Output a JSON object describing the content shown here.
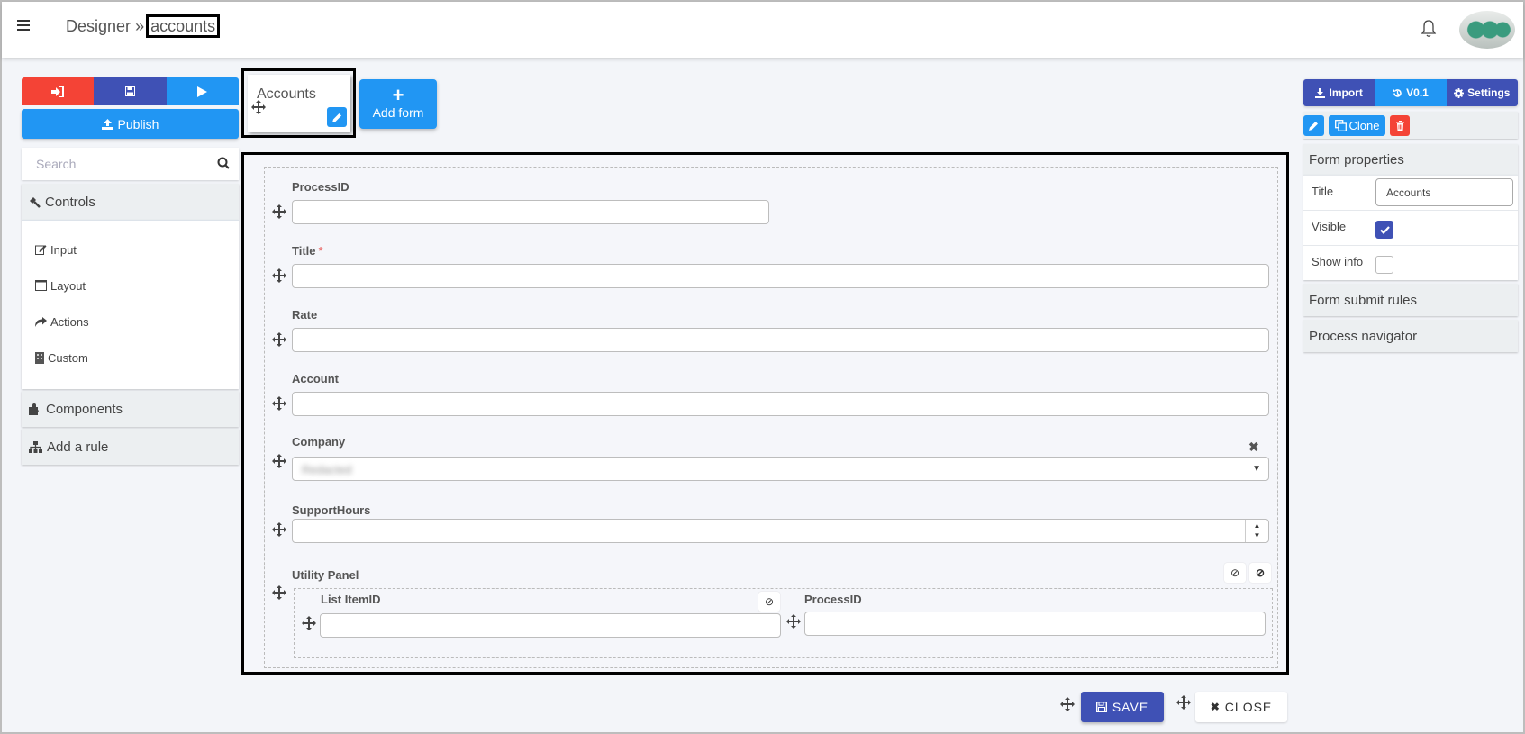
{
  "header": {
    "breadcrumb_root": "Designer",
    "breadcrumb_sep": "»",
    "breadcrumb_current": "accounts",
    "menu_icon": "hamburger-icon",
    "notification_icon": "bell-icon",
    "avatar": "user-avatar"
  },
  "left_sidebar": {
    "top_buttons": [
      {
        "icon": "sign-in-icon",
        "color": "#f44336"
      },
      {
        "icon": "save-icon",
        "color": "#3f51b5"
      },
      {
        "icon": "play-icon",
        "color": "#2196f3"
      }
    ],
    "publish_label": "Publish",
    "search_placeholder": "Search",
    "sections": {
      "controls": "Controls",
      "components": "Components",
      "add_rule": "Add a rule"
    },
    "controls_items": [
      {
        "label": "Input",
        "icon": "edit-icon"
      },
      {
        "label": "Layout",
        "icon": "columns-icon"
      },
      {
        "label": "Actions",
        "icon": "share-icon"
      },
      {
        "label": "Custom",
        "icon": "building-icon"
      }
    ]
  },
  "forms": {
    "tabs": [
      {
        "title": "Accounts"
      }
    ],
    "add_form_label": "Add form"
  },
  "canvas": {
    "fields": [
      {
        "label": "ProcessID",
        "type": "text",
        "value": "",
        "required": false
      },
      {
        "label": "Title",
        "type": "text",
        "value": "",
        "required": true
      },
      {
        "label": "Rate",
        "type": "text",
        "value": "",
        "required": false
      },
      {
        "label": "Account",
        "type": "text",
        "value": "",
        "required": false
      },
      {
        "label": "Company",
        "type": "select",
        "value": "Redacted",
        "required": false
      },
      {
        "label": "SupportHours",
        "type": "number",
        "value": "",
        "required": false
      }
    ],
    "required_marker": "*",
    "utility_panel": {
      "label": "Utility Panel",
      "fields": [
        {
          "label": "List ItemID",
          "value": ""
        },
        {
          "label": "ProcessID",
          "value": ""
        }
      ]
    }
  },
  "footer": {
    "save_label": "SAVE",
    "close_label": "CLOSE"
  },
  "right_panel": {
    "top_buttons": {
      "import": "Import",
      "version": "V0.1",
      "settings": "Settings"
    },
    "clone_label": "Clone",
    "form_properties": {
      "heading": "Form properties",
      "title_label": "Title",
      "title_value": "Accounts",
      "visible_label": "Visible",
      "visible_checked": true,
      "show_info_label": "Show info",
      "show_info_checked": false
    },
    "form_submit_rules": "Form submit rules",
    "process_navigator": "Process navigator"
  },
  "colors": {
    "red": "#f44336",
    "indigo": "#3f51b5",
    "blue": "#2196f3",
    "panel_grey": "#eceff1"
  }
}
